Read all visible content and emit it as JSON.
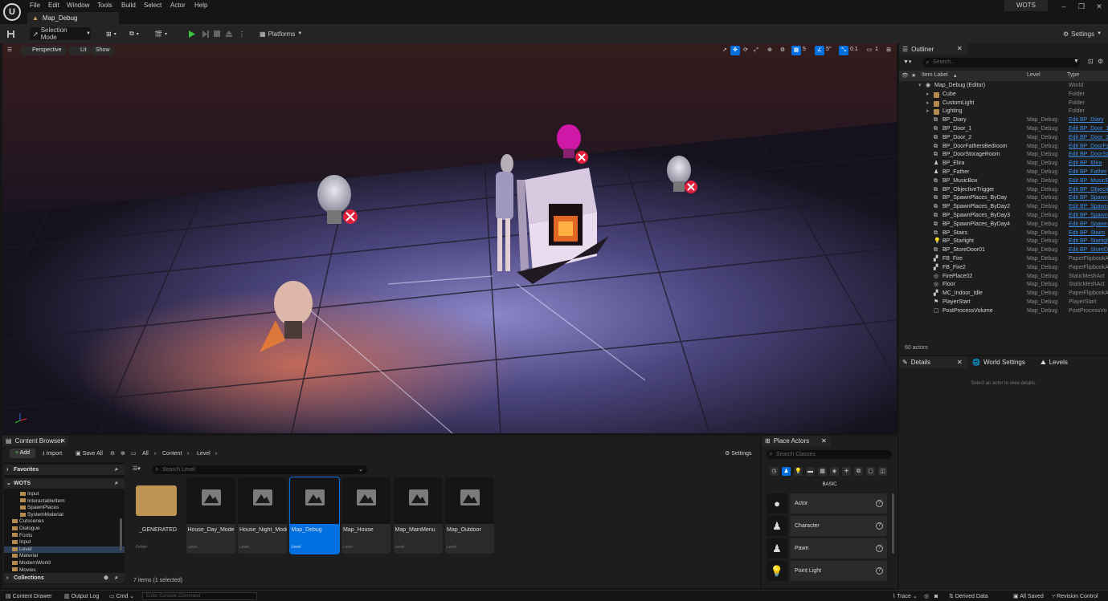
{
  "app": {
    "project": "WOTS",
    "menu": [
      "File",
      "Edit",
      "Window",
      "Tools",
      "Build",
      "Select",
      "Actor",
      "Help"
    ],
    "doc_tab": "Map_Debug"
  },
  "toolbar": {
    "selection_mode": "Selection Mode",
    "platforms": "Platforms",
    "settings": "Settings"
  },
  "viewport": {
    "perspective": "Perspective",
    "lit": "Lit",
    "show": "Show",
    "grid_size": "5",
    "rot_snap": "5°",
    "scale_snap": "0.1",
    "cam_speed": "1"
  },
  "outliner": {
    "tab": "Outliner",
    "search_placeholder": "Search...",
    "col_label": "Item Label",
    "col_level": "Level",
    "col_type": "Type",
    "actor_count": "60 actors",
    "rows": [
      {
        "label": "Map_Debug (Editor)",
        "level": "",
        "type": "World",
        "indent": 1,
        "icon": "world"
      },
      {
        "label": "Cube",
        "level": "",
        "type": "Folder",
        "indent": 2,
        "icon": "folder"
      },
      {
        "label": "CustomLight",
        "level": "",
        "type": "Folder",
        "indent": 2,
        "icon": "folder"
      },
      {
        "label": "Lighting",
        "level": "",
        "type": "Folder",
        "indent": 2,
        "icon": "folder"
      },
      {
        "label": "BP_Diary",
        "level": "Map_Debug",
        "type": "Edit BP_Diary",
        "indent": 2,
        "icon": "actor"
      },
      {
        "label": "BP_Door_1",
        "level": "Map_Debug",
        "type": "Edit BP_Door_1",
        "indent": 2,
        "icon": "actor"
      },
      {
        "label": "BP_Door_2",
        "level": "Map_Debug",
        "type": "Edit BP_Door_2",
        "indent": 2,
        "icon": "actor"
      },
      {
        "label": "BP_DoorFathersBedroom",
        "level": "Map_Debug",
        "type": "Edit BP_DoorFa",
        "indent": 2,
        "icon": "actor"
      },
      {
        "label": "BP_DoorStorageRoom",
        "level": "Map_Debug",
        "type": "Edit BP_DoorSt",
        "indent": 2,
        "icon": "actor"
      },
      {
        "label": "BP_Elira",
        "level": "Map_Debug",
        "type": "Edit BP_Elira",
        "indent": 2,
        "icon": "pawn"
      },
      {
        "label": "BP_Father",
        "level": "Map_Debug",
        "type": "Edit BP_Father",
        "indent": 2,
        "icon": "pawn"
      },
      {
        "label": "BP_MusicBox",
        "level": "Map_Debug",
        "type": "Edit BP_MusicE",
        "indent": 2,
        "icon": "actor"
      },
      {
        "label": "BP_ObjectiveTrigger",
        "level": "Map_Debug",
        "type": "Edit BP_Objecti",
        "indent": 2,
        "icon": "actor"
      },
      {
        "label": "BP_SpawnPlaces_ByDay",
        "level": "Map_Debug",
        "type": "Edit BP_Spawn",
        "indent": 2,
        "icon": "actor"
      },
      {
        "label": "BP_SpawnPlaces_ByDay2",
        "level": "Map_Debug",
        "type": "Edit BP_Spawn",
        "indent": 2,
        "icon": "actor"
      },
      {
        "label": "BP_SpawnPlaces_ByDay3",
        "level": "Map_Debug",
        "type": "Edit BP_Spawn",
        "indent": 2,
        "icon": "actor"
      },
      {
        "label": "BP_SpawnPlaces_ByDay4",
        "level": "Map_Debug",
        "type": "Edit BP_Spawn",
        "indent": 2,
        "icon": "actor"
      },
      {
        "label": "BP_Stairs",
        "level": "Map_Debug",
        "type": "Edit BP_Stairs",
        "indent": 2,
        "icon": "actor"
      },
      {
        "label": "BP_Starlight",
        "level": "Map_Debug",
        "type": "Edit BP_Starligl",
        "indent": 2,
        "icon": "light"
      },
      {
        "label": "BP_StoreDoor01",
        "level": "Map_Debug",
        "type": "Edit BP_StoreD",
        "indent": 2,
        "icon": "actor"
      },
      {
        "label": "FB_Fire",
        "level": "Map_Debug",
        "type": "PaperFlipbookA",
        "indent": 2,
        "icon": "flipbook"
      },
      {
        "label": "FB_Fire2",
        "level": "Map_Debug",
        "type": "PaperFlipbookA",
        "indent": 2,
        "icon": "flipbook"
      },
      {
        "label": "FirePlace02",
        "level": "Map_Debug",
        "type": "StaticMeshAct",
        "indent": 2,
        "icon": "mesh"
      },
      {
        "label": "Floor",
        "level": "Map_Debug",
        "type": "StaticMeshAct",
        "indent": 2,
        "icon": "mesh"
      },
      {
        "label": "MC_Indoor_Idle",
        "level": "Map_Debug",
        "type": "PaperFlipbookA",
        "indent": 2,
        "icon": "flipbook"
      },
      {
        "label": "PlayerStart",
        "level": "Map_Debug",
        "type": "PlayerStart",
        "indent": 2,
        "icon": "playerstart"
      },
      {
        "label": "PostProcessVolume",
        "level": "Map_Debug",
        "type": "PostProcessVo",
        "indent": 2,
        "icon": "volume"
      }
    ]
  },
  "details": {
    "tabs": [
      "Details",
      "World Settings",
      "Levels"
    ],
    "empty_text": "Select an actor to view details."
  },
  "content_browser": {
    "tab": "Content Browser",
    "add": "Add",
    "import": "Import",
    "save_all": "Save All",
    "breadcrumb": [
      "All",
      "Content",
      "Level"
    ],
    "settings": "Settings",
    "favorites": "Favorites",
    "project_root": "WOTS",
    "collections": "Collections",
    "search_placeholder": "Search Level",
    "tree": [
      {
        "label": "Input",
        "indent": 3
      },
      {
        "label": "InteractableItem",
        "indent": 3
      },
      {
        "label": "SpawnPlaces",
        "indent": 3
      },
      {
        "label": "SystemMaterial",
        "indent": 3
      },
      {
        "label": "Cutscenes",
        "indent": 2
      },
      {
        "label": "Dialogue",
        "indent": 2
      },
      {
        "label": "Fonts",
        "indent": 2
      },
      {
        "label": "Input",
        "indent": 2
      },
      {
        "label": "Level",
        "indent": 2,
        "selected": true
      },
      {
        "label": "Material",
        "indent": 2
      },
      {
        "label": "ModernWorld",
        "indent": 2
      },
      {
        "label": "Movies",
        "indent": 2
      }
    ],
    "assets": [
      {
        "name": "_GENERATED",
        "kind": "Folder",
        "folder": true
      },
      {
        "name": "House_Day_Mode",
        "kind": "Level"
      },
      {
        "name": "House_Night_Mode",
        "kind": "Level"
      },
      {
        "name": "Map_Debug",
        "kind": "Level",
        "selected": true
      },
      {
        "name": "Map_House",
        "kind": "Level"
      },
      {
        "name": "Map_MainMenu",
        "kind": "Level"
      },
      {
        "name": "Map_Outdoor",
        "kind": "Level"
      }
    ],
    "item_count": "7 items (1 selected)"
  },
  "place_actors": {
    "tab": "Place Actors",
    "search_placeholder": "Search Classes",
    "category": "BASIC",
    "items": [
      {
        "label": "Actor",
        "icon": "sphere"
      },
      {
        "label": "Character",
        "icon": "character"
      },
      {
        "label": "Pawn",
        "icon": "pawn"
      },
      {
        "label": "Point Light",
        "icon": "bulb"
      }
    ]
  },
  "statusbar": {
    "content_drawer": "Content Drawer",
    "output_log": "Output Log",
    "cmd": "Cmd",
    "console_placeholder": "Enter Console Command",
    "trace": "Trace",
    "derived_data": "Derived Data",
    "all_saved": "All Saved",
    "revision_control": "Revision Control"
  }
}
